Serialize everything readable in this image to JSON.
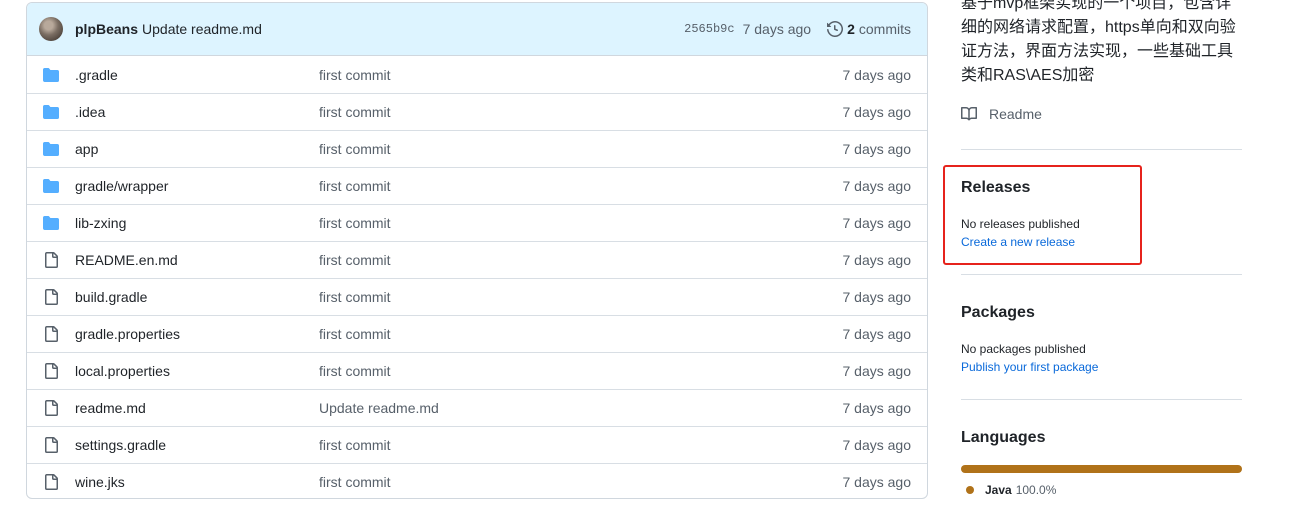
{
  "commit": {
    "author": "plpBeans",
    "message": "Update readme.md",
    "sha": "2565b9c",
    "age": "7 days ago",
    "count": "2",
    "count_word": "commits"
  },
  "files": [
    {
      "name": ".gradle",
      "type": "folder",
      "message": "first commit",
      "age": "7 days ago"
    },
    {
      "name": ".idea",
      "type": "folder",
      "message": "first commit",
      "age": "7 days ago"
    },
    {
      "name": "app",
      "type": "folder",
      "message": "first commit",
      "age": "7 days ago"
    },
    {
      "name": "gradle/wrapper",
      "type": "folder",
      "message": "first commit",
      "age": "7 days ago"
    },
    {
      "name": "lib-zxing",
      "type": "folder",
      "message": "first commit",
      "age": "7 days ago"
    },
    {
      "name": "README.en.md",
      "type": "file",
      "message": "first commit",
      "age": "7 days ago"
    },
    {
      "name": "build.gradle",
      "type": "file",
      "message": "first commit",
      "age": "7 days ago"
    },
    {
      "name": "gradle.properties",
      "type": "file",
      "message": "first commit",
      "age": "7 days ago"
    },
    {
      "name": "local.properties",
      "type": "file",
      "message": "first commit",
      "age": "7 days ago"
    },
    {
      "name": "readme.md",
      "type": "file",
      "message": "Update readme.md",
      "age": "7 days ago"
    },
    {
      "name": "settings.gradle",
      "type": "file",
      "message": "first commit",
      "age": "7 days ago"
    },
    {
      "name": "wine.jks",
      "type": "file",
      "message": "first commit",
      "age": "7 days ago"
    }
  ],
  "sidebar": {
    "about_lines": [
      "基于mvp框架实现的一个项目，包含详",
      "细的网络请求配置，https单向和双向验",
      "证方法，界面方法实现，一些基础工具",
      "类和RAS\\AES加密"
    ],
    "readme_label": "Readme",
    "releases": {
      "title": "Releases",
      "empty_text": "No releases published",
      "link": "Create a new release"
    },
    "packages": {
      "title": "Packages",
      "empty_text": "No packages published",
      "link": "Publish your first package"
    },
    "languages": {
      "title": "Languages",
      "items": [
        {
          "name": "Java",
          "percent": "100.0%",
          "fraction": 1.0,
          "color": "#b07219"
        }
      ]
    }
  },
  "colors": {
    "folder_icon": "#54aeff",
    "file_icon": "#57606a",
    "highlight": "#e6231c",
    "link": "#0969da"
  }
}
